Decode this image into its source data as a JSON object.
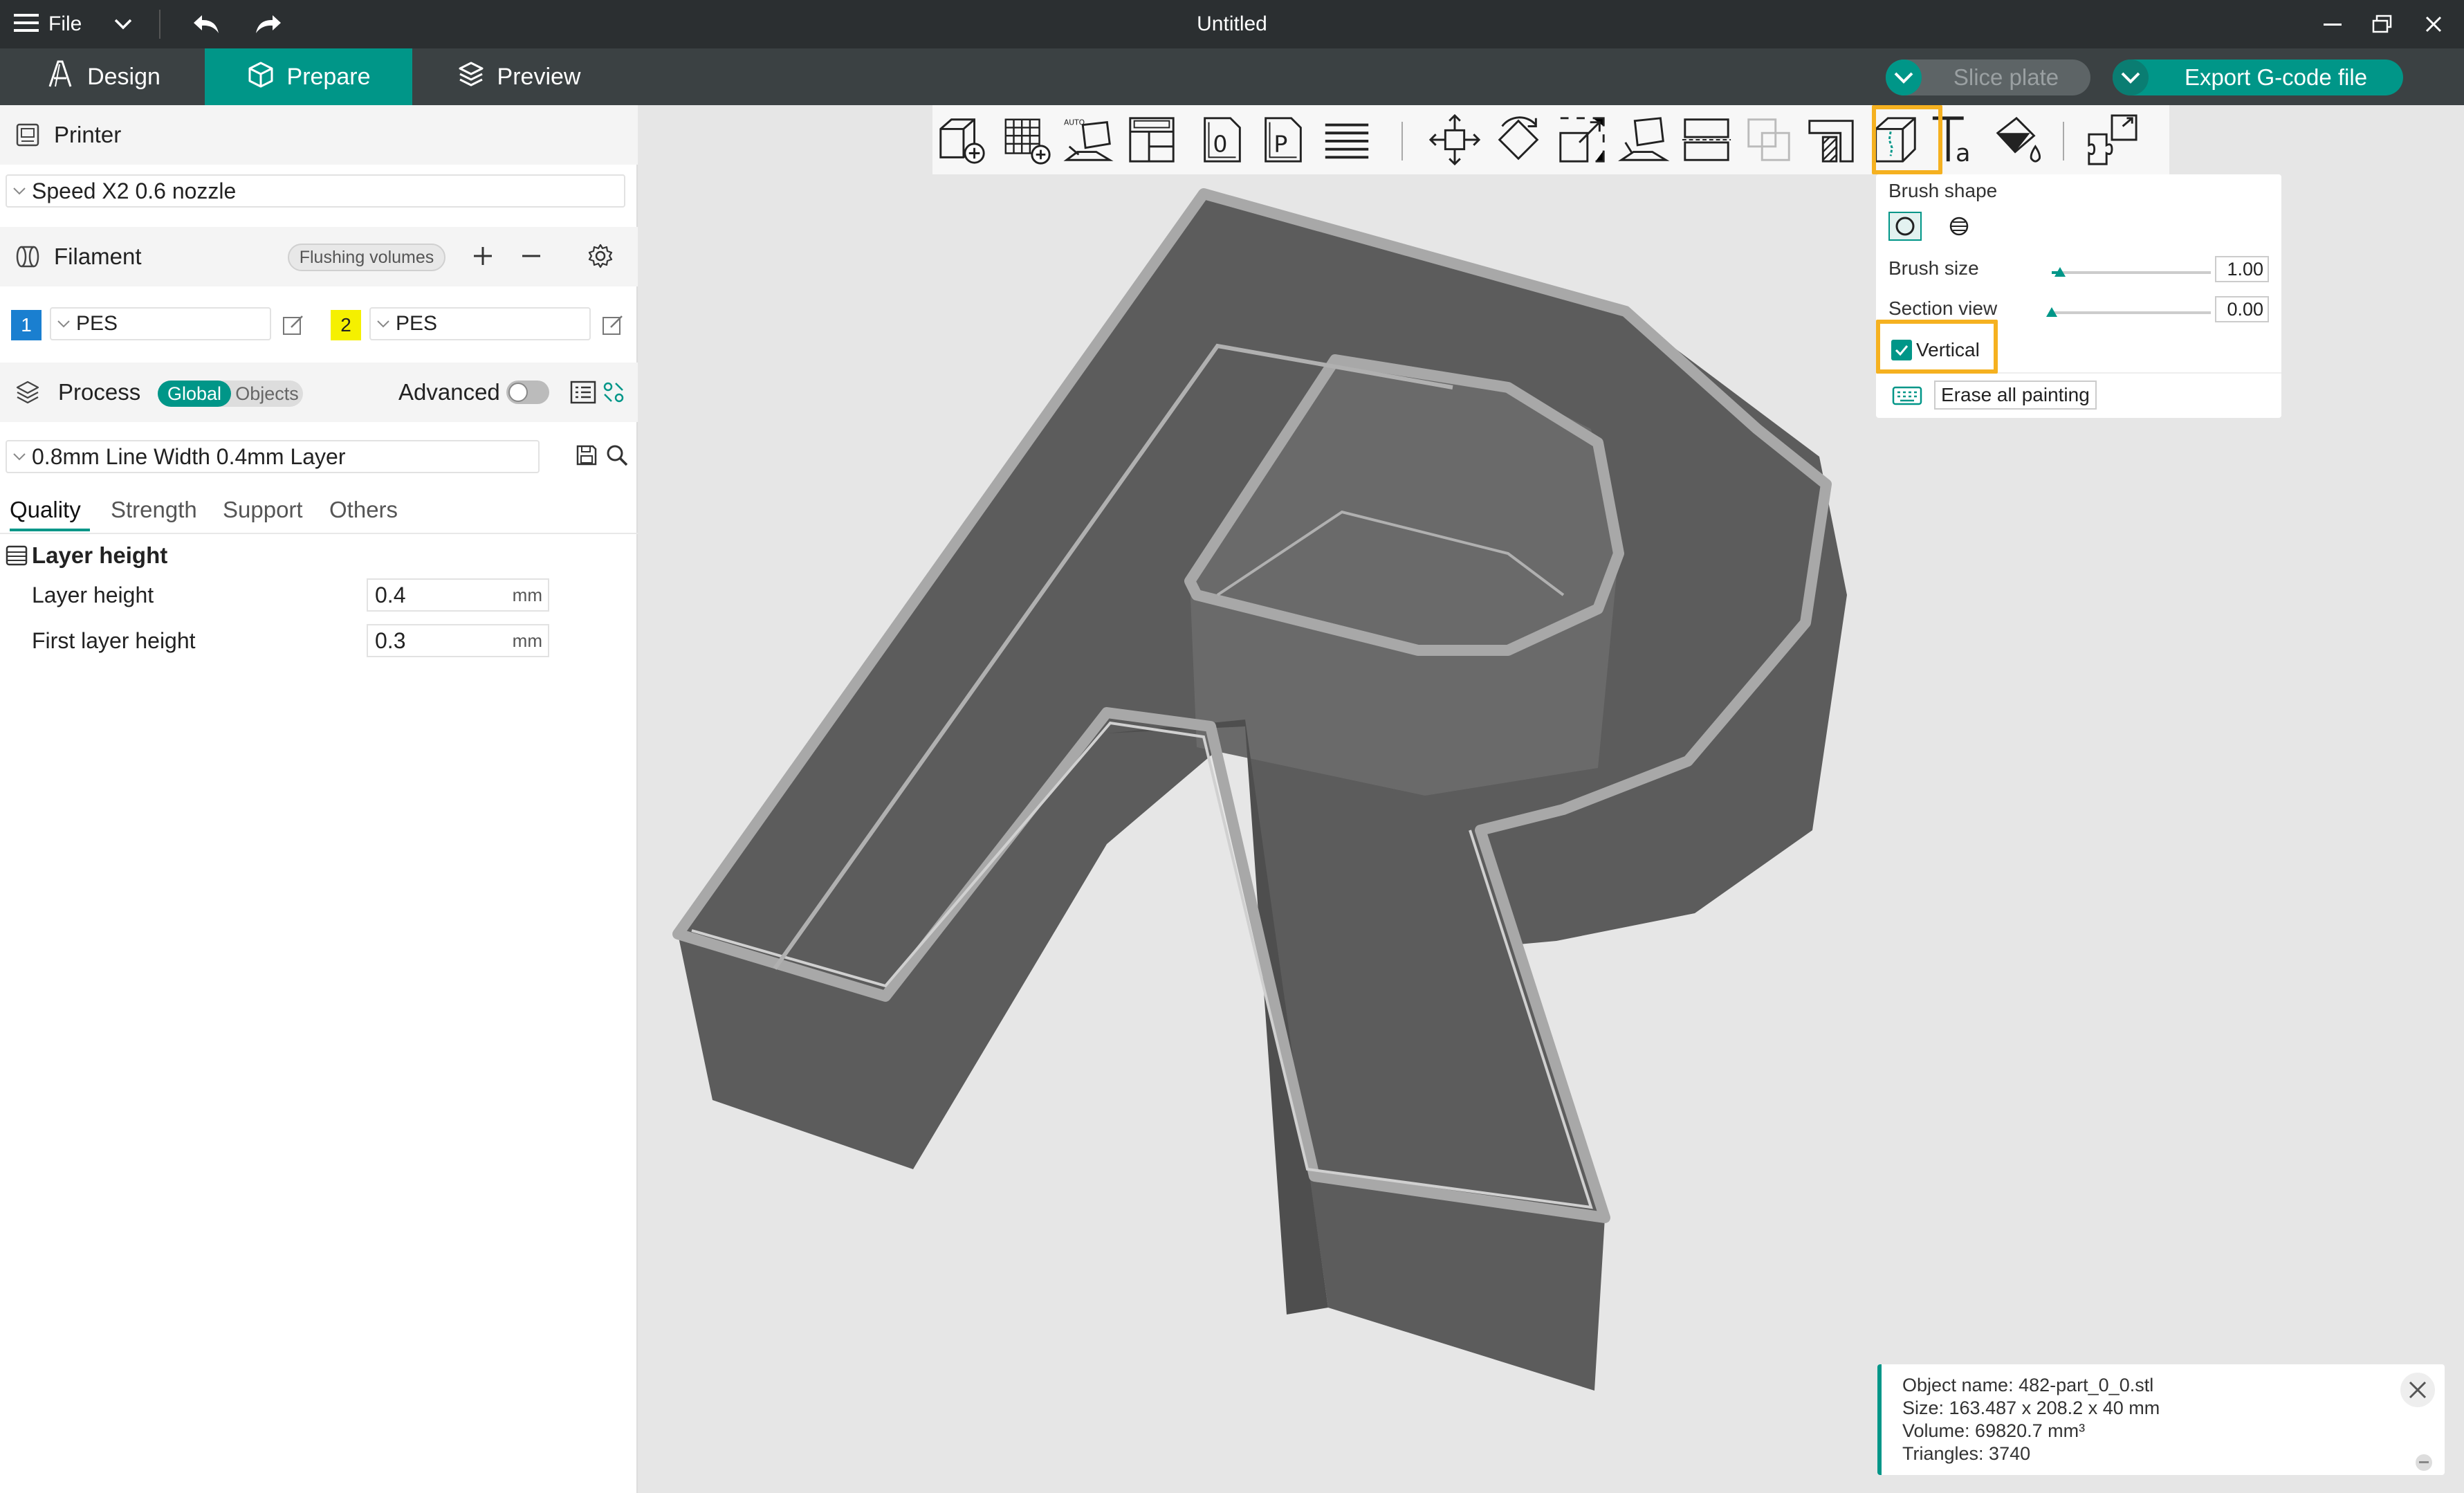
{
  "titlebar": {
    "file_label": "File",
    "title": "Untitled"
  },
  "tabs": [
    {
      "label": "Design"
    },
    {
      "label": "Prepare",
      "active": true
    },
    {
      "label": "Preview"
    }
  ],
  "actions": {
    "slice_label": "Slice plate",
    "export_label": "Export G-code file"
  },
  "printer": {
    "section_label": "Printer",
    "selected": "Speed X2 0.6 nozzle"
  },
  "filament": {
    "section_label": "Filament",
    "flushing_label": "Flushing volumes",
    "slots": [
      {
        "index": "1",
        "material": "PES",
        "color": "#1a7fd0"
      },
      {
        "index": "2",
        "material": "PES",
        "color": "#f5f000"
      }
    ]
  },
  "process": {
    "section_label": "Process",
    "global_label": "Global",
    "objects_label": "Objects",
    "advanced_label": "Advanced",
    "advanced_on": false,
    "preset": "0.8mm Line Width 0.4mm Layer",
    "tabs": [
      "Quality",
      "Strength",
      "Support",
      "Others"
    ],
    "active_tab": "Quality",
    "group_label": "Layer height",
    "fields": [
      {
        "label": "Layer height",
        "value": "0.4",
        "unit": "mm"
      },
      {
        "label": "First layer height",
        "value": "0.3",
        "unit": "mm"
      }
    ]
  },
  "paint_panel": {
    "brush_shape_label": "Brush shape",
    "brush_size_label": "Brush size",
    "brush_size_value": "1.00",
    "brush_size_fraction": 0.05,
    "section_view_label": "Section view",
    "section_view_value": "0.00",
    "section_view_fraction": 0.0,
    "vertical_label": "Vertical",
    "vertical_checked": true,
    "erase_label": "Erase all painting"
  },
  "info": {
    "name_line": "Object name: 482-part_0_0.stl",
    "size_line": "Size: 163.487 x 208.2 x 40 mm",
    "volume_line": "Volume: 69820.7 mm³",
    "triangles_line": "Triangles: 3740"
  },
  "colors": {
    "accent": "#009688",
    "highlight": "#f5b120",
    "titlebar": "#2b2f31",
    "tabbar": "#3b4143"
  },
  "toolbar_icons": [
    "add-cube-icon",
    "arrange-grid-icon",
    "auto-orient-icon",
    "layout-icon",
    "plate-0-icon",
    "plate-p-icon",
    "layers-list-icon",
    "move-icon",
    "rotate-icon",
    "scale-icon",
    "lay-on-face-icon",
    "cut-icon",
    "boolean-icon",
    "support-paint-icon",
    "seam-paint-icon",
    "text-icon",
    "color-paint-icon",
    "assembly-icon"
  ]
}
